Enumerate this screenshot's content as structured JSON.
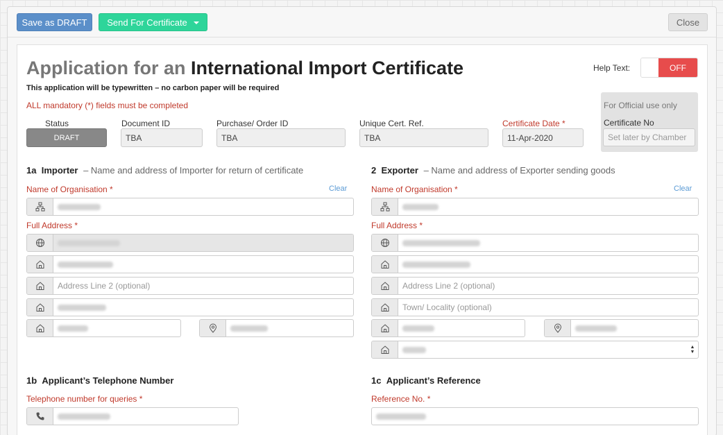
{
  "toolbar": {
    "save_draft": "Save as DRAFT",
    "send_certificate": "Send For Certificate",
    "close": "Close"
  },
  "header": {
    "title_light": "Application for an",
    "title_dark": "International Import Certificate",
    "subtitle": "This application will be typewritten – no carbon paper will be required",
    "mandatory_note": "ALL mandatory (*) fields must be completed",
    "help_text_label": "Help Text:",
    "help_toggle": "OFF"
  },
  "official": {
    "title": "For Official use only",
    "cert_no_label": "Certificate No",
    "cert_no_placeholder": "Set later by Chamber"
  },
  "meta": {
    "status_label": "Status",
    "status_value": "DRAFT",
    "document_id_label": "Document ID",
    "document_id_value": "TBA",
    "purchase_order_label": "Purchase/ Order ID",
    "purchase_order_value": "TBA",
    "unique_ref_label": "Unique Cert. Ref.",
    "unique_ref_value": "TBA",
    "cert_date_label": "Certificate Date",
    "cert_date_value": "11-Apr-2020",
    "required_star": "*"
  },
  "importer": {
    "number": "1a",
    "heading": "Importer",
    "description": "– Name and address of Importer for return of certificate",
    "org_label": "Name of Organisation *",
    "clear": "Clear",
    "address_label": "Full Address *",
    "address_line2_placeholder": "Address Line 2 (optional)"
  },
  "exporter": {
    "number": "2",
    "heading": "Exporter",
    "description": "– Name and address of Exporter sending goods",
    "org_label": "Name of Organisation *",
    "clear": "Clear",
    "address_label": "Full Address *",
    "address_line2_placeholder": "Address Line 2 (optional)",
    "town_placeholder": "Town/ Locality (optional)"
  },
  "telephone": {
    "number": "1b",
    "heading": "Applicant’s Telephone Number",
    "label": "Telephone number for queries *"
  },
  "reference": {
    "number": "1c",
    "heading": "Applicant’s Reference",
    "label": "Reference No. *"
  },
  "icons": {
    "org": "sitemap-icon",
    "country": "globe-icon",
    "address": "home-icon",
    "postcode": "map-marker-icon",
    "phone": "phone-icon"
  }
}
